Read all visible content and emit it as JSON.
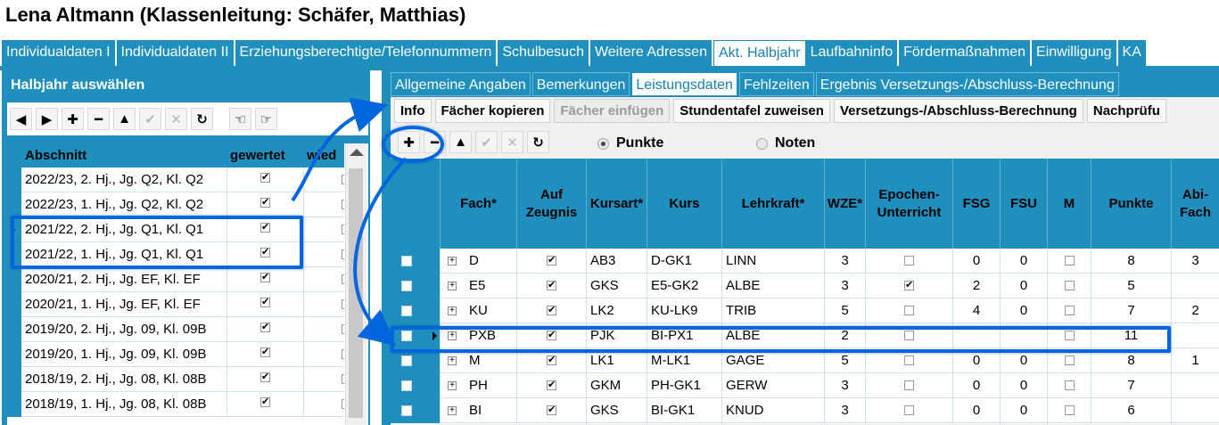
{
  "window": {
    "title": "Lena Altmann (Klassenleitung: Schäfer, Matthias)"
  },
  "main_tabs": [
    {
      "label": "Individualdaten I"
    },
    {
      "label": "Individualdaten II"
    },
    {
      "label": "Erziehungsberechtigte/Telefonnummern"
    },
    {
      "label": "Schulbesuch"
    },
    {
      "label": "Weitere Adressen"
    },
    {
      "label": "Akt. Halbjahr",
      "active": true
    },
    {
      "label": "Laufbahninfo"
    },
    {
      "label": "Fördermaßnahmen"
    },
    {
      "label": "Einwilligung"
    },
    {
      "label": "KA"
    }
  ],
  "left_panel": {
    "title": "Halbjahr auswählen",
    "toolbar": [
      {
        "icon": "prev-icon",
        "glyph": "◀",
        "enabled": true
      },
      {
        "icon": "next-icon",
        "glyph": "▶",
        "enabled": true
      },
      {
        "icon": "add-icon",
        "glyph": "✚",
        "enabled": true
      },
      {
        "icon": "remove-icon",
        "glyph": "━",
        "enabled": true
      },
      {
        "icon": "up-icon",
        "glyph": "▲",
        "enabled": true
      },
      {
        "icon": "confirm-icon",
        "glyph": "✔",
        "enabled": false
      },
      {
        "icon": "cancel-icon",
        "glyph": "✕",
        "enabled": false
      },
      {
        "icon": "refresh-icon",
        "glyph": "↻",
        "enabled": true
      },
      {
        "icon": "hand-left-icon",
        "glyph": "☜",
        "enabled": true
      },
      {
        "icon": "hand-right-icon",
        "glyph": "☞",
        "enabled": true
      }
    ],
    "columns": [
      "Abschnitt",
      "gewertet",
      "wied"
    ],
    "rows": [
      {
        "abschnitt": "2022/23, 2. Hj., Jg. Q2, Kl. Q2",
        "gewertet": true,
        "selected": false
      },
      {
        "abschnitt": "2022/23, 1. Hj., Jg. Q2, Kl. Q2",
        "gewertet": true,
        "selected": false
      },
      {
        "abschnitt": "2021/22, 2. Hj., Jg. Q1, Kl. Q1",
        "gewertet": true,
        "selected": true
      },
      {
        "abschnitt": "2021/22, 1. Hj., Jg. Q1, Kl. Q1",
        "gewertet": true,
        "selected": false
      },
      {
        "abschnitt": "2020/21, 2. Hj., Jg. EF, Kl. EF",
        "gewertet": true,
        "selected": false
      },
      {
        "abschnitt": "2020/21, 1. Hj., Jg. EF, Kl. EF",
        "gewertet": true,
        "selected": false
      },
      {
        "abschnitt": "2019/20, 2. Hj., Jg. 09, Kl. 09B",
        "gewertet": true,
        "selected": false
      },
      {
        "abschnitt": "2019/20, 1. Hj., Jg. 09, Kl. 09B",
        "gewertet": true,
        "selected": false
      },
      {
        "abschnitt": "2018/19, 2. Hj., Jg. 08, Kl. 08B",
        "gewertet": true,
        "selected": false
      },
      {
        "abschnitt": "2018/19, 1. Hj., Jg. 08, Kl. 08B",
        "gewertet": true,
        "selected": false
      }
    ]
  },
  "sub_tabs": [
    {
      "label": "Allgemeine Angaben"
    },
    {
      "label": "Bemerkungen"
    },
    {
      "label": "Leistungsdaten",
      "active": true
    },
    {
      "label": "Fehlzeiten"
    },
    {
      "label": "Ergebnis Versetzungs-/Abschluss-Berechnung"
    }
  ],
  "action_buttons": [
    {
      "label": "Info",
      "enabled": true
    },
    {
      "label": "Fächer kopieren",
      "enabled": true
    },
    {
      "label": "Fächer einfügen",
      "enabled": false
    },
    {
      "label": "Stundentafel zuweisen",
      "enabled": true
    },
    {
      "label": "Versetzungs-/Abschluss-Berechnung",
      "enabled": true
    },
    {
      "label": "Nachprüfu",
      "enabled": true
    }
  ],
  "right_toolbar": [
    {
      "icon": "add-icon",
      "glyph": "✚",
      "enabled": true
    },
    {
      "icon": "remove-icon",
      "glyph": "━",
      "enabled": true
    },
    {
      "icon": "up-icon",
      "glyph": "▲",
      "enabled": true
    },
    {
      "icon": "confirm-icon",
      "glyph": "✔",
      "enabled": false
    },
    {
      "icon": "cancel-icon",
      "glyph": "✕",
      "enabled": false
    },
    {
      "icon": "refresh-icon",
      "glyph": "↻",
      "enabled": true
    }
  ],
  "grade_mode": {
    "options": [
      "Punkte",
      "Noten"
    ],
    "selected": "Punkte"
  },
  "grades_table": {
    "columns": [
      "Fach*",
      "Auf Zeugnis",
      "Kursart*",
      "Kurs",
      "Lehrkraft*",
      "WZE*",
      "Epochen-Unterricht",
      "FSG",
      "FSU",
      "M",
      "Punkte",
      "Abi-Fach"
    ],
    "rows": [
      {
        "fach": "D",
        "auf_zeugnis": true,
        "kursart": "AB3",
        "kurs": "D-GK1",
        "lehrkraft": "LINN",
        "wze": "3",
        "epochen": false,
        "fsg": "0",
        "fsu": "0",
        "m": false,
        "punkte": "8",
        "abi": "3",
        "selected": false
      },
      {
        "fach": "E5",
        "auf_zeugnis": true,
        "kursart": "GKS",
        "kurs": "E5-GK2",
        "lehrkraft": "ALBE",
        "wze": "3",
        "epochen": true,
        "fsg": "2",
        "fsu": "0",
        "m": false,
        "punkte": "5",
        "abi": "",
        "selected": false
      },
      {
        "fach": "KU",
        "auf_zeugnis": true,
        "kursart": "LK2",
        "kurs": "KU-LK9",
        "lehrkraft": "TRIB",
        "wze": "5",
        "epochen": false,
        "fsg": "4",
        "fsu": "0",
        "m": false,
        "punkte": "7",
        "abi": "2",
        "selected": false
      },
      {
        "fach": "PXB",
        "auf_zeugnis": true,
        "kursart": "PJK",
        "kurs": "BI-PX1",
        "lehrkraft": "ALBE",
        "wze": "2",
        "epochen": false,
        "fsg": "",
        "fsu": "",
        "m": false,
        "punkte": "11",
        "abi": "",
        "selected": true
      },
      {
        "fach": "M",
        "auf_zeugnis": true,
        "kursart": "LK1",
        "kurs": "M-LK1",
        "lehrkraft": "GAGE",
        "wze": "5",
        "epochen": false,
        "fsg": "0",
        "fsu": "0",
        "m": false,
        "punkte": "8",
        "abi": "1",
        "selected": false
      },
      {
        "fach": "PH",
        "auf_zeugnis": true,
        "kursart": "GKM",
        "kurs": "PH-GK1",
        "lehrkraft": "GERW",
        "wze": "3",
        "epochen": false,
        "fsg": "0",
        "fsu": "0",
        "m": false,
        "punkte": "7",
        "abi": "",
        "selected": false
      },
      {
        "fach": "BI",
        "auf_zeugnis": true,
        "kursart": "GKS",
        "kurs": "BI-GK1",
        "lehrkraft": "KNUD",
        "wze": "3",
        "epochen": false,
        "fsg": "0",
        "fsu": "0",
        "m": false,
        "punkte": "6",
        "abi": "",
        "selected": false
      }
    ]
  },
  "colors": {
    "accent": "#1f8fbe",
    "highlight": "#0066dd"
  }
}
